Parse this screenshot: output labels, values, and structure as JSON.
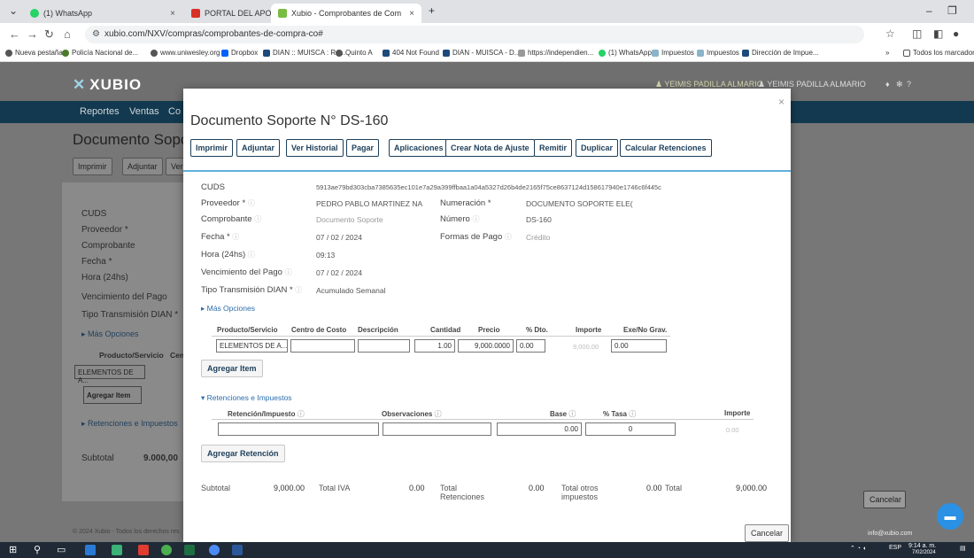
{
  "browser": {
    "tabs": [
      {
        "label": "(1) WhatsApp",
        "icon": "whatsapp-icon",
        "color": "#25d366"
      },
      {
        "label": "PORTAL DEL APORTANTE - com",
        "icon": "gmail-icon",
        "color": "#d93025"
      },
      {
        "label": "Xubio - Comprobantes de Com",
        "icon": "xubio-icon",
        "color": "#78bc43"
      }
    ],
    "url": "xubio.com/NXV/compras/comprobantes-de-compra-co#",
    "bookmarks": [
      {
        "label": "Nueva pestaña",
        "color": "#555"
      },
      {
        "label": "Policía Nacional de...",
        "color": "#4a7a2a"
      },
      {
        "label": "www.uniwesley.org",
        "color": "#555"
      },
      {
        "label": "Dropbox",
        "color": "#0061fe"
      },
      {
        "label": "DIAN :: MUISCA : Re...",
        "color": "#1c4a7a"
      },
      {
        "label": "Quinto A",
        "color": "#555"
      },
      {
        "label": "404 Not Found",
        "color": "#1c4a7a"
      },
      {
        "label": "DIAN - MUISCA - D...",
        "color": "#1c4a7a"
      },
      {
        "label": "https://independien...",
        "color": "#999"
      },
      {
        "label": "(1) WhatsApp",
        "color": "#25d366"
      },
      {
        "label": "Impuestos",
        "color": "#8ab4c9"
      },
      {
        "label": "Impuestos",
        "color": "#8ab4c9"
      },
      {
        "label": "Dirección de Impue...",
        "color": "#1c4a7a"
      }
    ],
    "more_bookmarks": "»",
    "all_bookmarks": "Todos los marcadores"
  },
  "app": {
    "logo": "XUBIO",
    "user1": "YEIMIS PADILLA ALMARIO",
    "user2": "YEIMIS PADILLA ALMARIO",
    "nav": [
      "Reportes",
      "Ventas",
      "Co"
    ],
    "bg_title": "Documento Soporte",
    "bg_buttons": [
      "Imprimir",
      "Adjuntar",
      "Ver"
    ],
    "bg_labels": [
      "CUDS",
      "Proveedor *",
      "Comprobante",
      "Fecha *",
      "Hora (24hs)",
      "Vencimiento del Pago",
      "Tipo Transmisión DIAN *"
    ],
    "bg_mas": "Más Opciones",
    "bg_prod_header": "Producto/Servicio",
    "bg_prod_header2": "Cen",
    "bg_prod_value": "ELEMENTOS DE A...",
    "bg_agregar": "Agregar Item",
    "bg_retenciones": "Retenciones e Impuestos",
    "bg_subtotal_label": "Subtotal",
    "bg_subtotal_value": "9.000,00",
    "footer": "© 2024 Xubio - Todos los derechos res",
    "cancel": "Cancelar",
    "email": "info@xubio.com"
  },
  "modal": {
    "title": "Documento Soporte N° DS-160",
    "buttons": [
      "Imprimir",
      "Adjuntar",
      "Ver Historial",
      "Pagar",
      "Aplicaciones",
      "Crear Nota de Ajuste",
      "Remitir",
      "Duplicar",
      "Calcular Retenciones"
    ],
    "cuds_label": "CUDS",
    "cuds_value": "5913ae79bd303cba7385635ec101e7a29a399ffbaa1a04a5327d26b4de2165f75ce8637124d158617940e1746c6f445c",
    "proveedor_label": "Proveedor *",
    "proveedor_value": "PEDRO PABLO MARTINEZ NA",
    "numeracion_label": "Numeración *",
    "numeracion_value": "DOCUMENTO SOPORTE ELE(",
    "comprobante_label": "Comprobante",
    "comprobante_value": "Documento Soporte",
    "numero_label": "Número",
    "numero_value": "DS-160",
    "fecha_label": "Fecha *",
    "fecha_value": "07 / 02 / 2024",
    "formas_label": "Formas de Pago",
    "formas_value": "Crédito",
    "hora_label": "Hora (24hs)",
    "hora_value": "09:13",
    "venc_label": "Vencimiento del Pago",
    "venc_value": "07 / 02 / 2024",
    "tipo_label": "Tipo Transmisión DIAN *",
    "tipo_value": "Acumulado Semanal",
    "mas_opciones": "Más Opciones",
    "items_headers": [
      "Producto/Servicio",
      "Centro de Costo",
      "Descripción",
      "Cantidad",
      "Precio",
      "% Dto.",
      "Importe",
      "Exe/No Grav."
    ],
    "item_row": {
      "producto": "ELEMENTOS DE A...",
      "centro": "",
      "descripcion": "",
      "cantidad": "1.00",
      "precio": "9,000.0000",
      "dto": "0.00",
      "importe": "9,000.00",
      "exe": "0.00"
    },
    "agregar_item": "Agregar Item",
    "retenciones_toggle": "Retenciones e Impuestos",
    "ret_headers": [
      "Retención/Impuesto",
      "Observaciones",
      "Base",
      "% Tasa",
      "Importe"
    ],
    "ret_row": {
      "retencion": "",
      "observaciones": "",
      "base": "0.00",
      "tasa": "0",
      "importe": "0.00"
    },
    "agregar_retencion": "Agregar Retención",
    "summary": {
      "subtotal_label": "Subtotal",
      "subtotal_value": "9,000.00",
      "iva_label": "Total IVA",
      "iva_value": "0.00",
      "ret_label1": "Total",
      "ret_label2": "Retenciones",
      "ret_value": "0.00",
      "otros_label1": "Total otros",
      "otros_label2": "impuestos",
      "otros_value": "0.00",
      "total_label": "Total",
      "total_value": "9,000.00"
    },
    "cancelar": "Cancelar"
  },
  "taskbar": {
    "lang": "ESP",
    "time": "9:14 a. m.",
    "date": "7/02/2024"
  }
}
